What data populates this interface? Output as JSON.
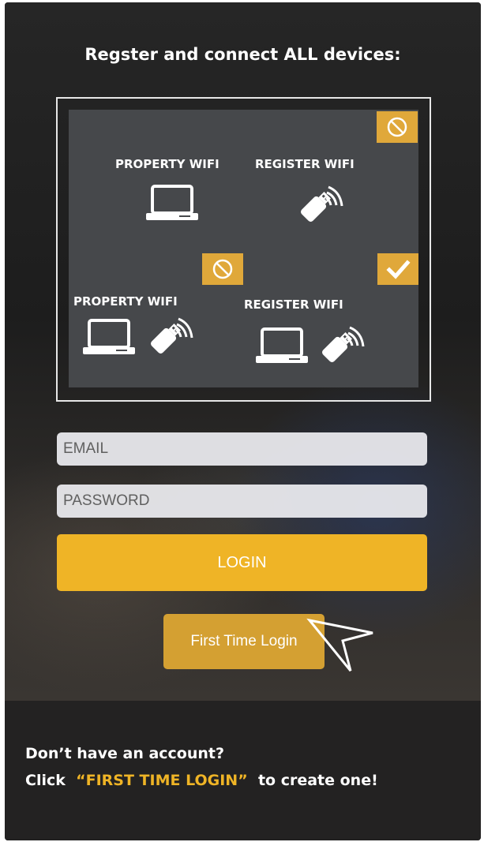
{
  "heading": "Regster and connect ALL devices:",
  "diagram": {
    "top_left_label": "PROPERTY WIFI",
    "top_right_label": "REGISTER WIFI",
    "bottom_left_label": "PROPERTY WIFI",
    "bottom_right_label": "REGISTER WIFI",
    "badges": [
      "prohibited-icon",
      "prohibited-icon",
      "checkmark-icon"
    ]
  },
  "form": {
    "email_placeholder": "EMAIL",
    "password_placeholder": "PASSWORD",
    "login_label": "LOGIN",
    "first_time_label": "First Time Login"
  },
  "footer": {
    "line1": "Don’t have an account?",
    "line2_prefix": "Click",
    "line2_highlight": "“FIRST TIME LOGIN”",
    "line2_suffix": "to create one!"
  },
  "colors": {
    "accent": "#efb426",
    "badge": "#e0a83a",
    "panel": "#46484b",
    "background": "#232323"
  }
}
